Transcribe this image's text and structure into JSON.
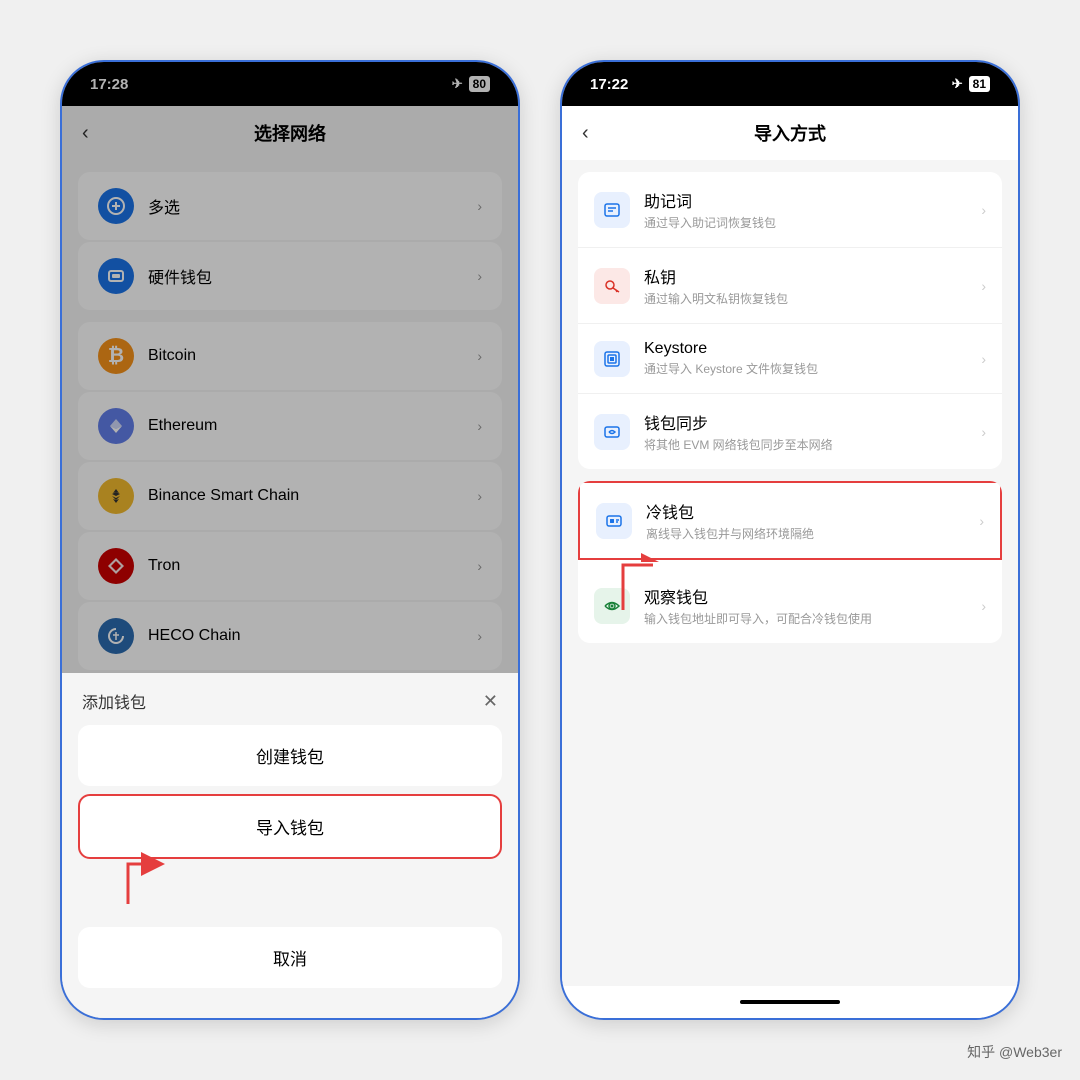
{
  "left_phone": {
    "status_time": "17:28",
    "battery": "80",
    "nav_title": "选择网络",
    "back_icon": "‹",
    "networks": [
      {
        "id": "multiselect",
        "label": "多选",
        "icon_char": "✦",
        "icon_class": "icon-multiselect"
      },
      {
        "id": "hardware",
        "label": "硬件钱包",
        "icon_char": "▣",
        "icon_class": "icon-hardware"
      },
      {
        "id": "bitcoin",
        "label": "Bitcoin",
        "icon_char": "₿",
        "icon_class": "icon-bitcoin"
      },
      {
        "id": "ethereum",
        "label": "Ethereum",
        "icon_char": "◈",
        "icon_class": "icon-ethereum"
      },
      {
        "id": "bnb",
        "label": "Binance Smart Chain",
        "icon_char": "◆",
        "icon_class": "icon-bnb"
      },
      {
        "id": "tron",
        "label": "Tron",
        "icon_char": "✦",
        "icon_class": "icon-tron"
      },
      {
        "id": "heco",
        "label": "HECO Chain",
        "icon_char": "🔥",
        "icon_class": "icon-heco"
      }
    ],
    "sheet_title": "添加钱包",
    "sheet_create": "创建钱包",
    "sheet_import": "导入钱包",
    "sheet_cancel": "取消"
  },
  "right_phone": {
    "status_time": "17:22",
    "battery": "81",
    "nav_title": "导入方式",
    "back_icon": "‹",
    "import_groups": [
      {
        "items": [
          {
            "id": "mnemonic",
            "icon_char": "▦",
            "icon_class": "icon-mnemonic",
            "title": "助记词",
            "desc": "通过导入助记词恢复钱包"
          },
          {
            "id": "privatekey",
            "icon_char": "🔑",
            "icon_class": "icon-privatekey",
            "title": "私钥",
            "desc": "通过输入明文私钥恢复钱包"
          },
          {
            "id": "keystore",
            "icon_char": "▨",
            "icon_class": "icon-keystore",
            "title": "Keystore",
            "desc": "通过导入 Keystore 文件恢复钱包"
          },
          {
            "id": "walletsync",
            "icon_char": "⟳",
            "icon_class": "icon-walletsync",
            "title": "钱包同步",
            "desc": "将其他 EVM 网络钱包同步至本网络"
          }
        ]
      },
      {
        "items": [
          {
            "id": "coldwallet",
            "icon_char": "▦",
            "icon_class": "icon-coldwallet",
            "title": "冷钱包",
            "desc": "离线导入钱包并与网络环境隔绝",
            "highlighted": true
          },
          {
            "id": "watchonly",
            "icon_char": "◎",
            "icon_class": "icon-watchonly",
            "title": "观察钱包",
            "desc": "输入钱包地址即可导入，可配合冷钱包使用"
          }
        ]
      }
    ]
  },
  "watermark": "知乎 @Web3er"
}
